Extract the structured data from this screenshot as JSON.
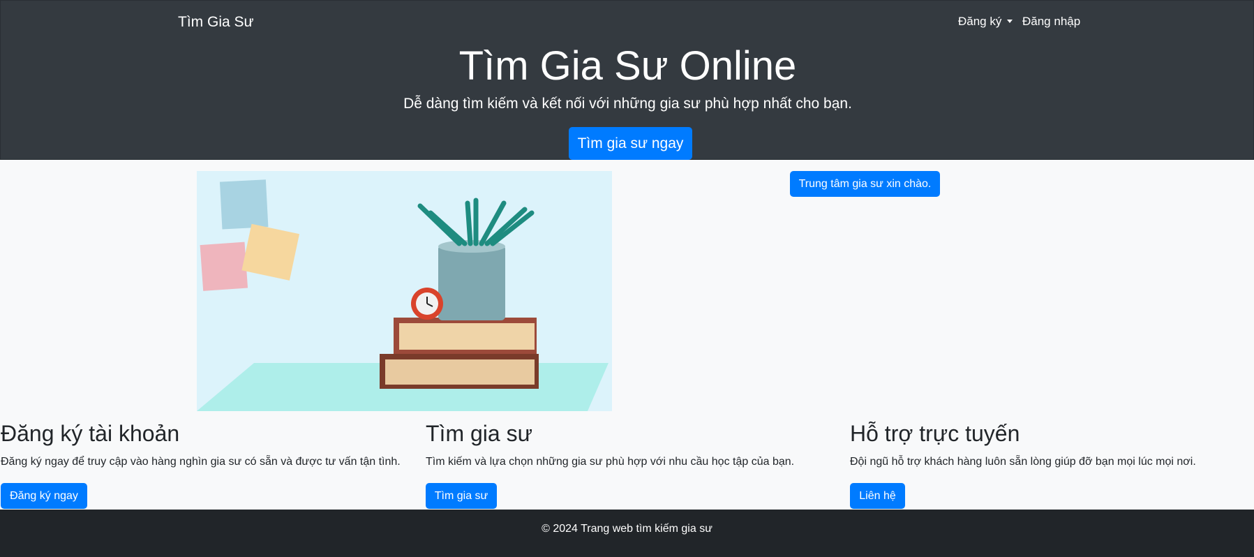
{
  "navbar": {
    "brand": "Tìm Gia Sư",
    "signup_label": "Đăng ký",
    "login_label": "Đăng nhập"
  },
  "hero": {
    "title": "Tìm Gia Sư Online",
    "subtitle": "Dễ dàng tìm kiếm và kết nối với những gia sư phù hợp nhất cho bạn.",
    "cta_label": "Tìm gia sư ngay"
  },
  "main": {
    "greeting_button": "Trung tâm gia sư xin chào.",
    "features": [
      {
        "title": "Đăng ký tài khoản",
        "description": "Đăng ký ngay để truy cập vào hàng nghìn gia sư có sẵn và được tư vấn tận tình.",
        "button": "Đăng ký ngay"
      },
      {
        "title": "Tìm gia sư",
        "description": "Tìm kiếm và lựa chọn những gia sư phù hợp với nhu cầu học tập của bạn.",
        "button": "Tìm gia sư"
      },
      {
        "title": "Hỗ trợ trực tuyến",
        "description": "Đội ngũ hỗ trợ khách hàng luôn sẵn lòng giúp đỡ bạn mọi lúc mọi nơi.",
        "button": "Liên hệ"
      }
    ]
  },
  "footer": {
    "text": "© 2024 Trang web tìm kiếm gia sư"
  },
  "colors": {
    "header_bg": "#343a40",
    "footer_bg": "#212529",
    "primary": "#007bff",
    "page_bg": "#f8f9fa"
  }
}
